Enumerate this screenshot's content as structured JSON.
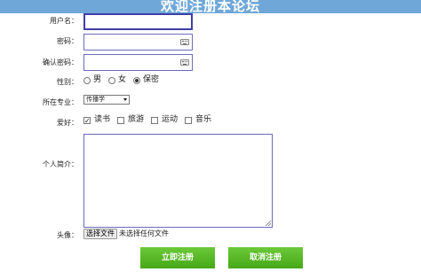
{
  "header": {
    "title": "欢迎注册本论坛"
  },
  "form": {
    "username_label": "用户名：",
    "password_label": "密码：",
    "confirm_password_label": "确认密码：",
    "gender_label": "性别：",
    "gender_options": [
      "男",
      "女",
      "保密"
    ],
    "gender_selected": "保密",
    "major_label": "所在专业：",
    "major_selected": "传播学",
    "hobby_label": "爱好：",
    "hobby_options": [
      "读书",
      "旅游",
      "运动",
      "音乐"
    ],
    "hobby_checked": [
      "读书"
    ],
    "bio_label": "个人简介：",
    "avatar_label": "头像：",
    "file_button_label": "选择文件",
    "file_status": "未选择任何文件"
  },
  "buttons": {
    "submit_label": "立即注册",
    "cancel_label": "取消注册"
  },
  "colors": {
    "header_bg": "#6fa8d8",
    "button_green": "#4fb81f",
    "input_border": "#6b6bbf"
  }
}
